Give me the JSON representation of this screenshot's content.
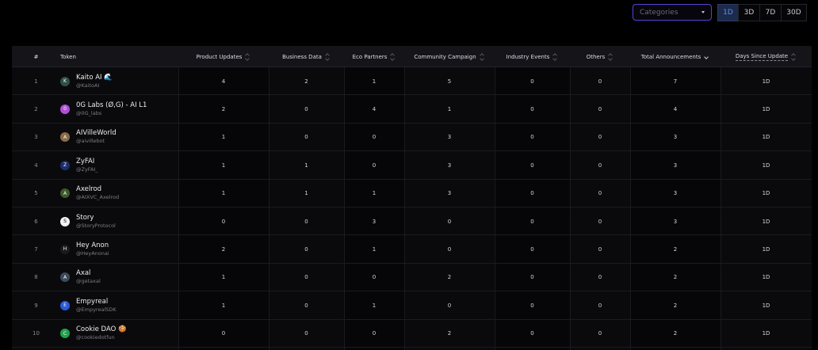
{
  "filters": {
    "categories_placeholder": "Categories",
    "ranges": [
      {
        "label": "1D",
        "active": true
      },
      {
        "label": "3D",
        "active": false
      },
      {
        "label": "7D",
        "active": false
      },
      {
        "label": "30D",
        "active": false
      }
    ]
  },
  "table": {
    "headers": {
      "rank": "#",
      "token": "Token",
      "product_updates": "Product Updates",
      "business_data": "Business Data",
      "eco_partners": "Eco Partners",
      "community_campaign": "Community Campaign",
      "industry_events": "Industry Events",
      "others": "Others",
      "total_announcements": "Total Announcements",
      "days_since_update": "Days Since Update"
    },
    "rows": [
      {
        "rank": "1",
        "name": "Kaito AI 🌊",
        "handle": "@KaitoAI",
        "avatar_color": "#2f4f4a",
        "avatar_icon": "K",
        "product_updates": "4",
        "business_data": "2",
        "eco_partners": "1",
        "community_campaign": "5",
        "industry_events": "0",
        "others": "0",
        "total_announcements": "7",
        "days_since_update": "1D"
      },
      {
        "rank": "2",
        "name": "0G Labs (Ø,G) - AI L1",
        "handle": "@0G_labs",
        "avatar_color": "#b04fd8",
        "avatar_icon": "0",
        "product_updates": "2",
        "business_data": "0",
        "eco_partners": "4",
        "community_campaign": "1",
        "industry_events": "0",
        "others": "0",
        "total_announcements": "4",
        "days_since_update": "1D"
      },
      {
        "rank": "3",
        "name": "AIVilleWorld",
        "handle": "@aivillebot",
        "avatar_color": "#8a6a4a",
        "avatar_icon": "A",
        "product_updates": "1",
        "business_data": "0",
        "eco_partners": "0",
        "community_campaign": "3",
        "industry_events": "0",
        "others": "0",
        "total_announcements": "3",
        "days_since_update": "1D"
      },
      {
        "rank": "4",
        "name": "ZyFAI",
        "handle": "@ZyFAI_",
        "avatar_color": "#1c2e6a",
        "avatar_icon": "Z",
        "product_updates": "1",
        "business_data": "1",
        "eco_partners": "0",
        "community_campaign": "3",
        "industry_events": "0",
        "others": "0",
        "total_announcements": "3",
        "days_since_update": "1D"
      },
      {
        "rank": "5",
        "name": "Axelrod",
        "handle": "@AIXVC_Axelrod",
        "avatar_color": "#3d5a2a",
        "avatar_icon": "A",
        "product_updates": "1",
        "business_data": "1",
        "eco_partners": "1",
        "community_campaign": "3",
        "industry_events": "0",
        "others": "0",
        "total_announcements": "3",
        "days_since_update": "1D"
      },
      {
        "rank": "6",
        "name": "Story",
        "handle": "@StoryProtocol",
        "avatar_color": "#f2f2f2",
        "avatar_icon": "S",
        "product_updates": "0",
        "business_data": "0",
        "eco_partners": "3",
        "community_campaign": "0",
        "industry_events": "0",
        "others": "0",
        "total_announcements": "3",
        "days_since_update": "1D"
      },
      {
        "rank": "7",
        "name": "Hey Anon",
        "handle": "@HeyAnonai",
        "avatar_color": "#1a1a1a",
        "avatar_icon": "H",
        "product_updates": "2",
        "business_data": "0",
        "eco_partners": "1",
        "community_campaign": "0",
        "industry_events": "0",
        "others": "0",
        "total_announcements": "2",
        "days_since_update": "1D"
      },
      {
        "rank": "8",
        "name": "Axal",
        "handle": "@getaxal",
        "avatar_color": "#3a4a5a",
        "avatar_icon": "A",
        "product_updates": "1",
        "business_data": "0",
        "eco_partners": "0",
        "community_campaign": "2",
        "industry_events": "0",
        "others": "0",
        "total_announcements": "2",
        "days_since_update": "1D"
      },
      {
        "rank": "9",
        "name": "Empyreal",
        "handle": "@EmpyrealSDK",
        "avatar_color": "#2a5ad8",
        "avatar_icon": "E",
        "product_updates": "1",
        "business_data": "0",
        "eco_partners": "1",
        "community_campaign": "0",
        "industry_events": "0",
        "others": "0",
        "total_announcements": "2",
        "days_since_update": "1D"
      },
      {
        "rank": "10",
        "name": "Cookie DAO 🍪",
        "handle": "@cookiedotfun",
        "avatar_color": "#1fa34a",
        "avatar_icon": "C",
        "product_updates": "0",
        "business_data": "0",
        "eco_partners": "0",
        "community_campaign": "2",
        "industry_events": "0",
        "others": "0",
        "total_announcements": "2",
        "days_since_update": "1D"
      }
    ]
  }
}
